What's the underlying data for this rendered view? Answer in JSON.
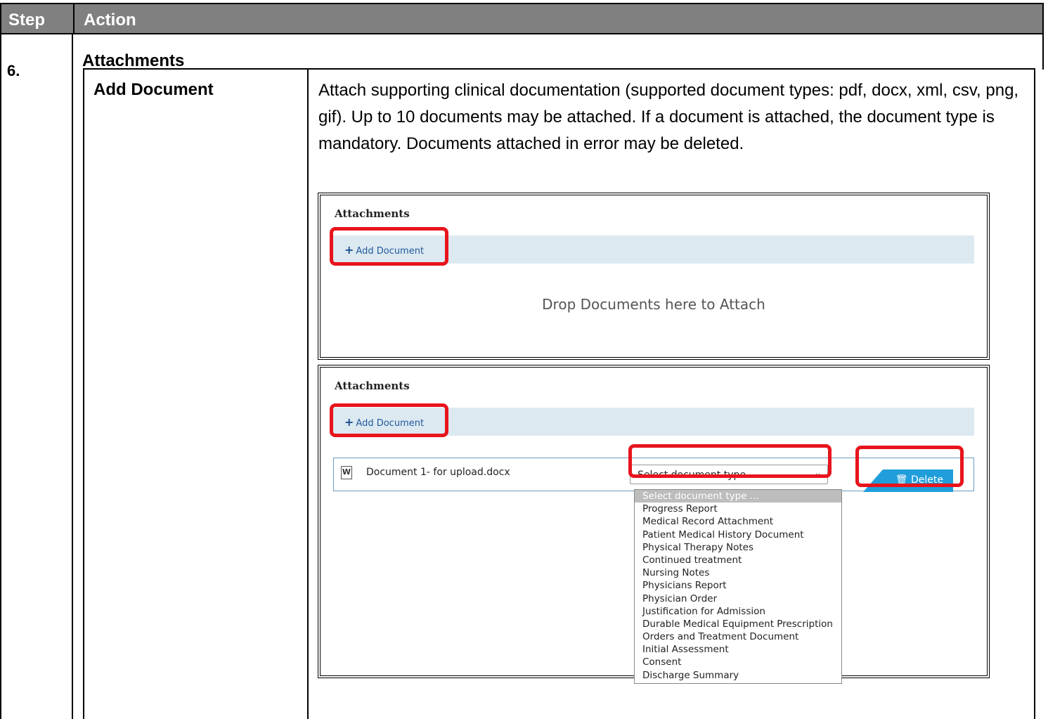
{
  "header": {
    "step": "Step",
    "action": "Action"
  },
  "row": {
    "step_number": "6.",
    "section_title": "Attachments",
    "subsection": "Add Document",
    "description": "Attach supporting clinical documentation (supported document types: pdf, docx, xml, csv, png, gif). Up to 10 documents may be attached. If a document is attached, the document type is mandatory. Documents attached in error may be deleted."
  },
  "shot1": {
    "title": "Attachments",
    "add_label": "Add Document",
    "drop_text": "Drop Documents here to Attach"
  },
  "shot2": {
    "title": "Attachments",
    "add_label": "Add Document",
    "document_name": "Document 1- for upload.docx",
    "select_value": "Select document type ...",
    "delete_label": "Delete",
    "options": [
      "Select document type ...",
      "Progress Report",
      "Medical Record Attachment",
      "Patient Medical History Document",
      "Physical Therapy Notes",
      "Continued treatment",
      "Nursing Notes",
      "Physicians Report",
      "Physician Order",
      "Justification for Admission",
      "Durable Medical Equipment Prescription",
      "Orders and Treatment Document",
      "Initial Assessment",
      "Consent",
      "Discharge Summary"
    ]
  },
  "colors": {
    "highlight": "#e8141c",
    "header_bg": "#808080",
    "bar_bg": "#dce9f1",
    "delete_bg": "#1f9edb"
  }
}
